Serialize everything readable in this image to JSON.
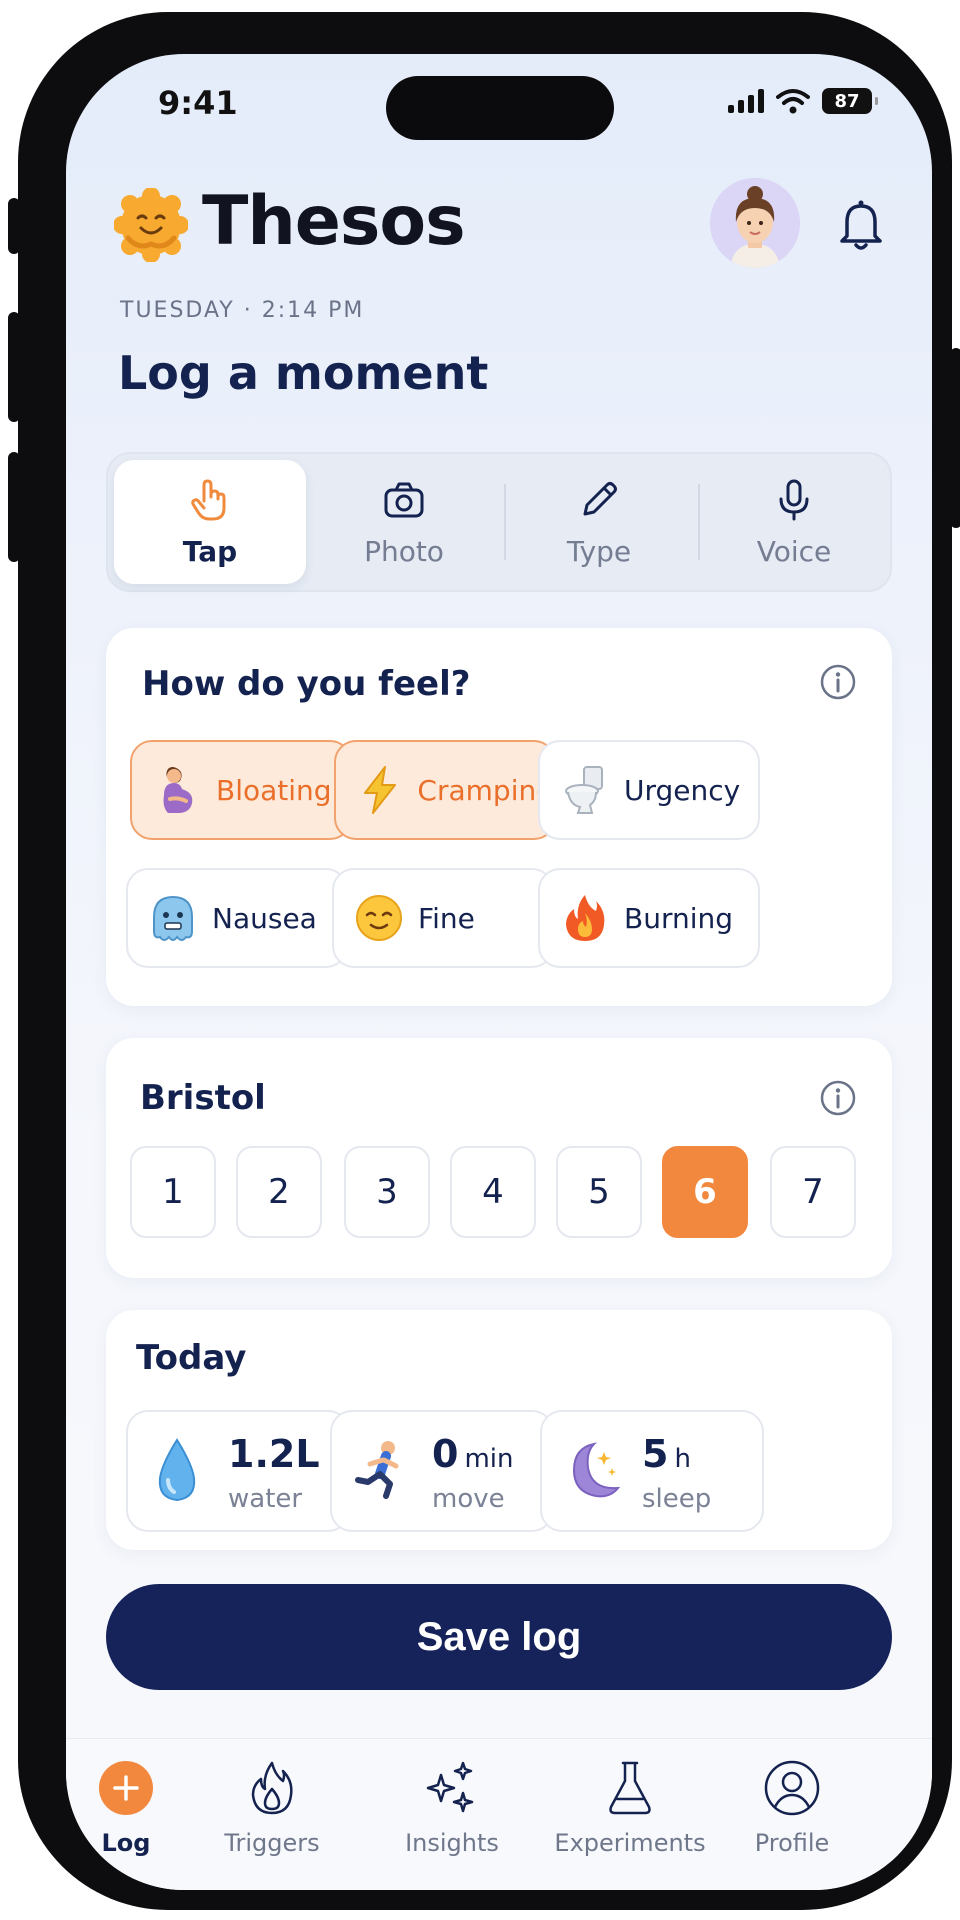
{
  "status_bar": {
    "time": "9:41",
    "battery": "87"
  },
  "header": {
    "app_name": "Thesos",
    "day_time": "TUESDAY · 2:14 PM",
    "page_title": "Log a moment"
  },
  "input_modes": [
    {
      "label": "Tap",
      "icon": "hand-pointer-icon",
      "active": true
    },
    {
      "label": "Photo",
      "icon": "camera-icon",
      "active": false
    },
    {
      "label": "Type",
      "icon": "pencil-icon",
      "active": false
    },
    {
      "label": "Voice",
      "icon": "microphone-icon",
      "active": false
    }
  ],
  "feelings": {
    "title": "How do you feel?",
    "options": [
      {
        "label": "Bloating",
        "icon": "pregnant-woman-emoji",
        "selected": true
      },
      {
        "label": "Cramping",
        "icon": "lightning-emoji",
        "selected": true
      },
      {
        "label": "Urgency",
        "icon": "toilet-emoji",
        "selected": false
      },
      {
        "label": "Nausea",
        "icon": "cold-face-emoji",
        "selected": false
      },
      {
        "label": "Fine",
        "icon": "relieved-face-emoji",
        "selected": false
      },
      {
        "label": "Burning",
        "icon": "fire-emoji",
        "selected": false
      }
    ]
  },
  "bristol": {
    "title": "Bristol",
    "options": [
      "1",
      "2",
      "3",
      "4",
      "5",
      "6",
      "7"
    ],
    "selected": "6"
  },
  "today": {
    "title": "Today",
    "stats": [
      {
        "value": "1.2L",
        "unit": "",
        "label": "water",
        "icon": "water-drop-emoji"
      },
      {
        "value": "0",
        "unit": "min",
        "label": "move",
        "icon": "runner-emoji"
      },
      {
        "value": "5",
        "unit": "h",
        "label": "sleep",
        "icon": "crescent-moon-emoji"
      }
    ]
  },
  "save_label": "Save log",
  "tabbar": [
    {
      "label": "Log",
      "icon": "plus-circle-icon",
      "active": true
    },
    {
      "label": "Triggers",
      "icon": "flame-icon",
      "active": false
    },
    {
      "label": "Insights",
      "icon": "sparkles-icon",
      "active": false
    },
    {
      "label": "Experiments",
      "icon": "flask-icon",
      "active": false
    },
    {
      "label": "Profile",
      "icon": "user-circle-icon",
      "active": false
    }
  ],
  "colors": {
    "accent": "#F2873E",
    "navy": "#16235A",
    "selected_chip_bg": "#FDEADB"
  }
}
